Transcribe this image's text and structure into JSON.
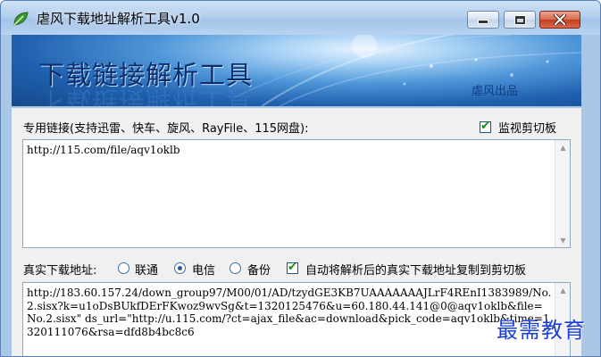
{
  "window": {
    "title": "虐风下载地址解析工具v1.0",
    "icon": "leaf-app-icon",
    "controls": {
      "minimize": "minimize-icon",
      "maximize": "maximize-icon",
      "close": "close-icon"
    }
  },
  "banner": {
    "title": "下载链接解析工具",
    "credit": "虐风出品"
  },
  "special_link": {
    "label": "专用链接(支持迅雷、快车、旋风、RayFile、115网盘):",
    "monitor_label": "监视剪切板",
    "monitor_checked": true,
    "value": "http://115.com/file/aqv1oklb"
  },
  "real_address": {
    "label": "真实下载地址:",
    "options": [
      {
        "label": "联通",
        "selected": false
      },
      {
        "label": "电信",
        "selected": true
      },
      {
        "label": "备份",
        "selected": false
      }
    ],
    "auto_copy_label": "自动将解析后的真实下载地址复制到剪切板",
    "auto_copy_checked": true,
    "value": "http://183.60.157.24/down_group97/M00/01/AD/tzydGE3KB7UAAAAAAAJLrF4REnI1383989/No.2.sisx?k=u1oDsBUkfDErFKwoz9wvSg&t=1320125476&u=60.180.44.141@0@aqv1oklb&file=No.2.sisx\" ds_url=\"http://u.115.com/?ct=ajax_file&ac=download&pick_code=aqv1oklb&time=1320111076&rsa=dfd8b4bc8c6"
  },
  "watermark": "最需教育",
  "colors": {
    "accent": "#1f5fad",
    "check": "#1a8a1a",
    "watermark": "#1a3fd8"
  }
}
